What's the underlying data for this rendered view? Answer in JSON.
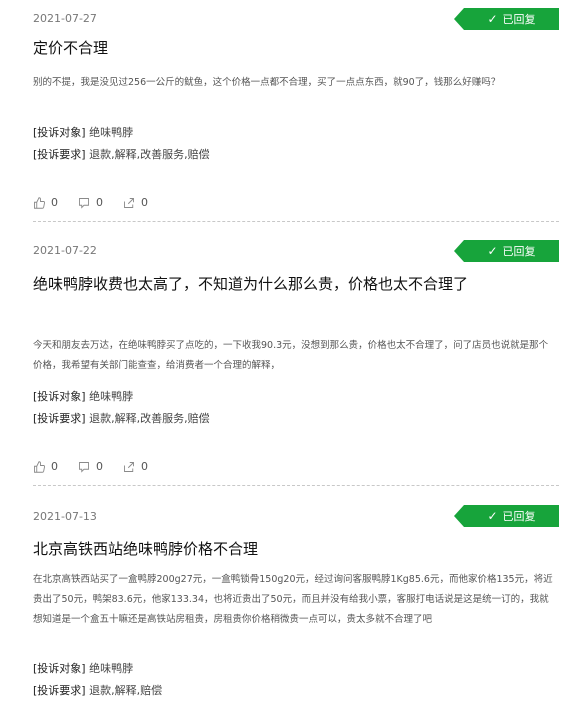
{
  "items": [
    {
      "date": "2021-07-27",
      "badge": "已回复",
      "title": "定价不合理",
      "content": "别的不提，我是没见过256一公斤的鱿鱼，这个价格一点都不合理，买了一点点东西，就90了，钱那么好赚吗？",
      "target_label": "[投诉对象]",
      "target_value": "绝味鸭脖",
      "req_label": "[投诉要求]",
      "req_value": "退款,解释,改善服务,赔偿",
      "likes": "0",
      "comments": "0",
      "shares": "0"
    },
    {
      "date": "2021-07-22",
      "badge": "已回复",
      "title": "绝味鸭脖收费也太高了，不知道为什么那么贵，价格也太不合理了",
      "content": "今天和朋友去万达，在绝味鸭脖买了点吃的，一下收我90.3元，没想到那么贵，价格也太不合理了，问了店员也说就是那个价格，我希望有关部门能查查，给消费者一个合理的解释，",
      "target_label": "[投诉对象]",
      "target_value": "绝味鸭脖",
      "req_label": "[投诉要求]",
      "req_value": "退款,解释,改善服务,赔偿",
      "likes": "0",
      "comments": "0",
      "shares": "0"
    },
    {
      "date": "2021-07-13",
      "badge": "已回复",
      "title": "北京高铁西站绝味鸭脖价格不合理",
      "content": "在北京高铁西站买了一盒鸭脖200g27元，一盒鸭锁骨150g20元，经过询问客服鸭脖1Kg85.6元，而他家价格135元，将近贵出了50元，鸭架83.6元，他家133.34，也将近贵出了50元，而且并没有给我小票，客服打电话说是这是统一订的，我就想知道是一个盒五十嘛还是高铁站房租贵，房租贵你价格稍微贵一点可以，贵太多就不合理了吧",
      "target_label": "[投诉对象]",
      "target_value": "绝味鸭脖",
      "req_label": "[投诉要求]",
      "req_value": "退款,解释,赔偿"
    }
  ]
}
